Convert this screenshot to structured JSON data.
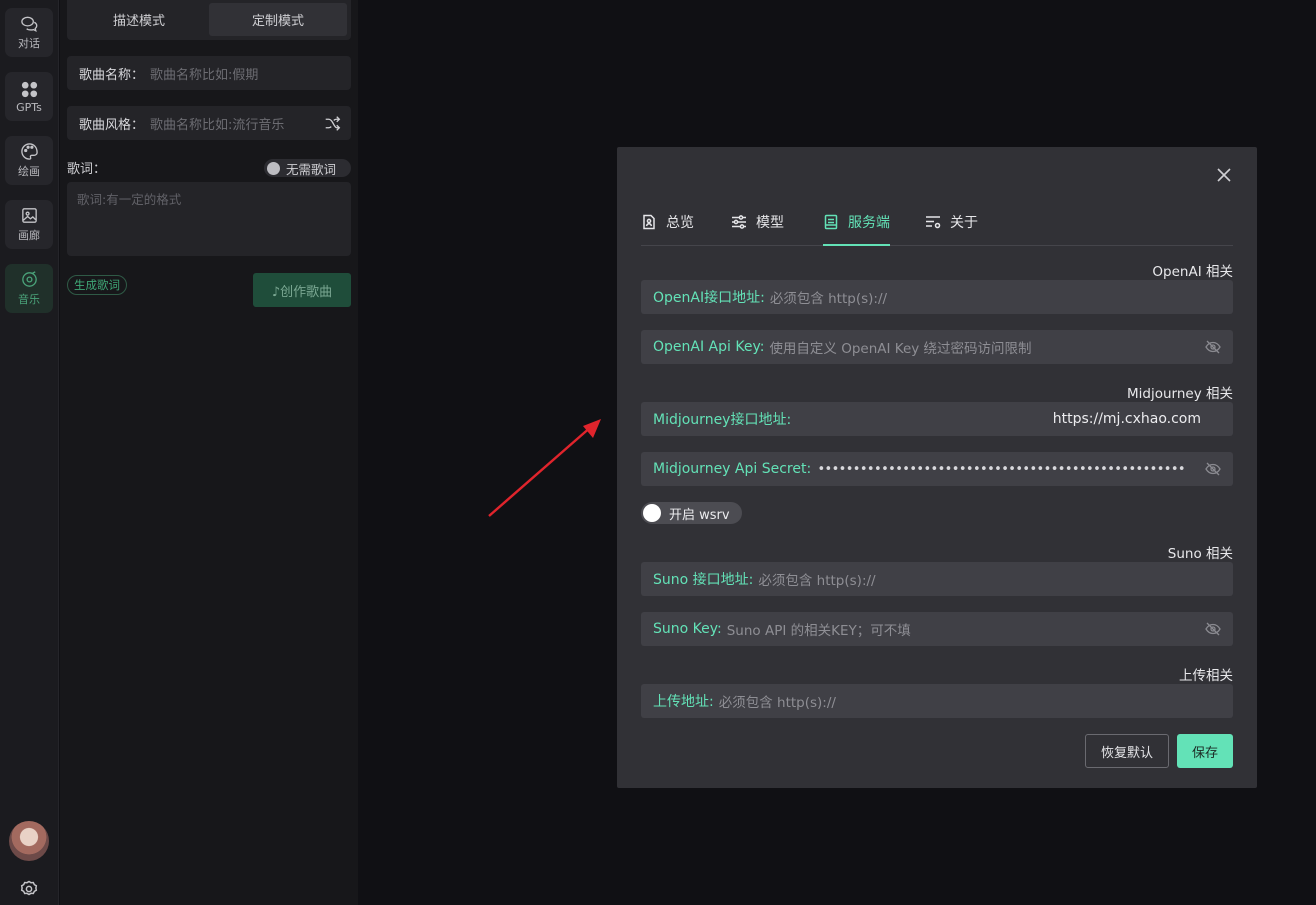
{
  "rail": {
    "items": [
      {
        "label": "对话",
        "icon": "chat-icon"
      },
      {
        "label": "GPTs",
        "icon": "apps-grid-icon"
      },
      {
        "label": "绘画",
        "icon": "palette-icon"
      },
      {
        "label": "画廊",
        "icon": "image-icon"
      },
      {
        "label": "音乐",
        "icon": "music-disc-icon"
      }
    ],
    "active": "音乐"
  },
  "panel": {
    "modes": [
      "描述模式",
      "定制模式"
    ],
    "selected_mode": "定制模式",
    "song_name": {
      "label": "歌曲名称：",
      "placeholder": "歌曲名称比如:假期"
    },
    "song_style": {
      "label": "歌曲风格：",
      "placeholder": "歌曲名称比如:流行音乐"
    },
    "lyrics_label": "歌词：",
    "no_lyrics_toggle": "无需歌词",
    "lyrics_placeholder": "歌词:有一定的格式",
    "generate_lyrics": "生成歌词",
    "create_song": "♪创作歌曲"
  },
  "modal": {
    "tabs": [
      {
        "label": "总览",
        "icon": "overview-doc-icon"
      },
      {
        "label": "模型",
        "icon": "sliders-icon"
      },
      {
        "label": "服务端",
        "icon": "server-icon"
      },
      {
        "label": "关于",
        "icon": "settings-list-icon"
      }
    ],
    "active_tab": "服务端",
    "openai": {
      "section": "OpenAI 相关",
      "url_label": "OpenAI接口地址:",
      "url_placeholder": "必须包含 http(s)://",
      "key_label": "OpenAI Api Key:",
      "key_placeholder": "使用自定义 OpenAI Key 绕过密码访问限制"
    },
    "midjourney": {
      "section": "Midjourney 相关",
      "url_label": "Midjourney接口地址:",
      "url_value": "https://mj.cxhao.com",
      "secret_label": "Midjourney Api Secret:",
      "secret_value": "••••••••••••••••••••••••••••••••••••••••••••••••••••",
      "wsrv_toggle": "开启 wsrv"
    },
    "suno": {
      "section": "Suno 相关",
      "url_label": "Suno 接口地址:",
      "url_placeholder": "必须包含 http(s)://",
      "key_label": "Suno Key:",
      "key_placeholder": "Suno API 的相关KEY；可不填"
    },
    "upload": {
      "section": "上传相关",
      "url_label": "上传地址:",
      "url_placeholder": "必须包含 http(s)://"
    },
    "buttons": {
      "reset": "恢复默认",
      "save": "保存"
    }
  },
  "colors": {
    "accent": "#63e2b7",
    "arrow": "#e0242c"
  }
}
